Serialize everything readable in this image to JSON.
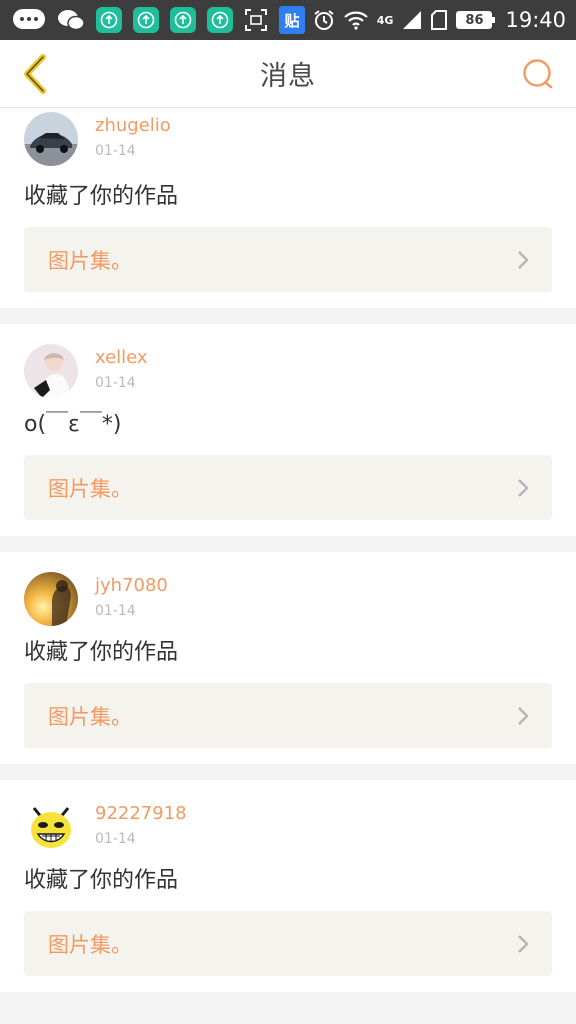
{
  "status_bar": {
    "network": "4G",
    "battery": "86",
    "time": "19:40",
    "paste_label": "贴"
  },
  "header": {
    "title": "消息"
  },
  "colors": {
    "accent": "#f39a62",
    "back_icon": "#f0c419",
    "link_bg": "#f4f3ee"
  },
  "notifications": [
    {
      "username": "zhugelio",
      "date": "01-14",
      "message": "收藏了你的作品",
      "link_label": "图片集。",
      "avatar": "car-avatar"
    },
    {
      "username": "xellex",
      "date": "01-14",
      "message": "o(￣ε￣*)",
      "link_label": "图片集。",
      "avatar": "girl-avatar"
    },
    {
      "username": "jyh7080",
      "date": "01-14",
      "message": "收藏了你的作品",
      "link_label": "图片集。",
      "avatar": "sunset-avatar"
    },
    {
      "username": "92227918",
      "date": "01-14",
      "message": "收藏了你的作品",
      "link_label": "图片集。",
      "avatar": "yellow-face-avatar"
    }
  ]
}
